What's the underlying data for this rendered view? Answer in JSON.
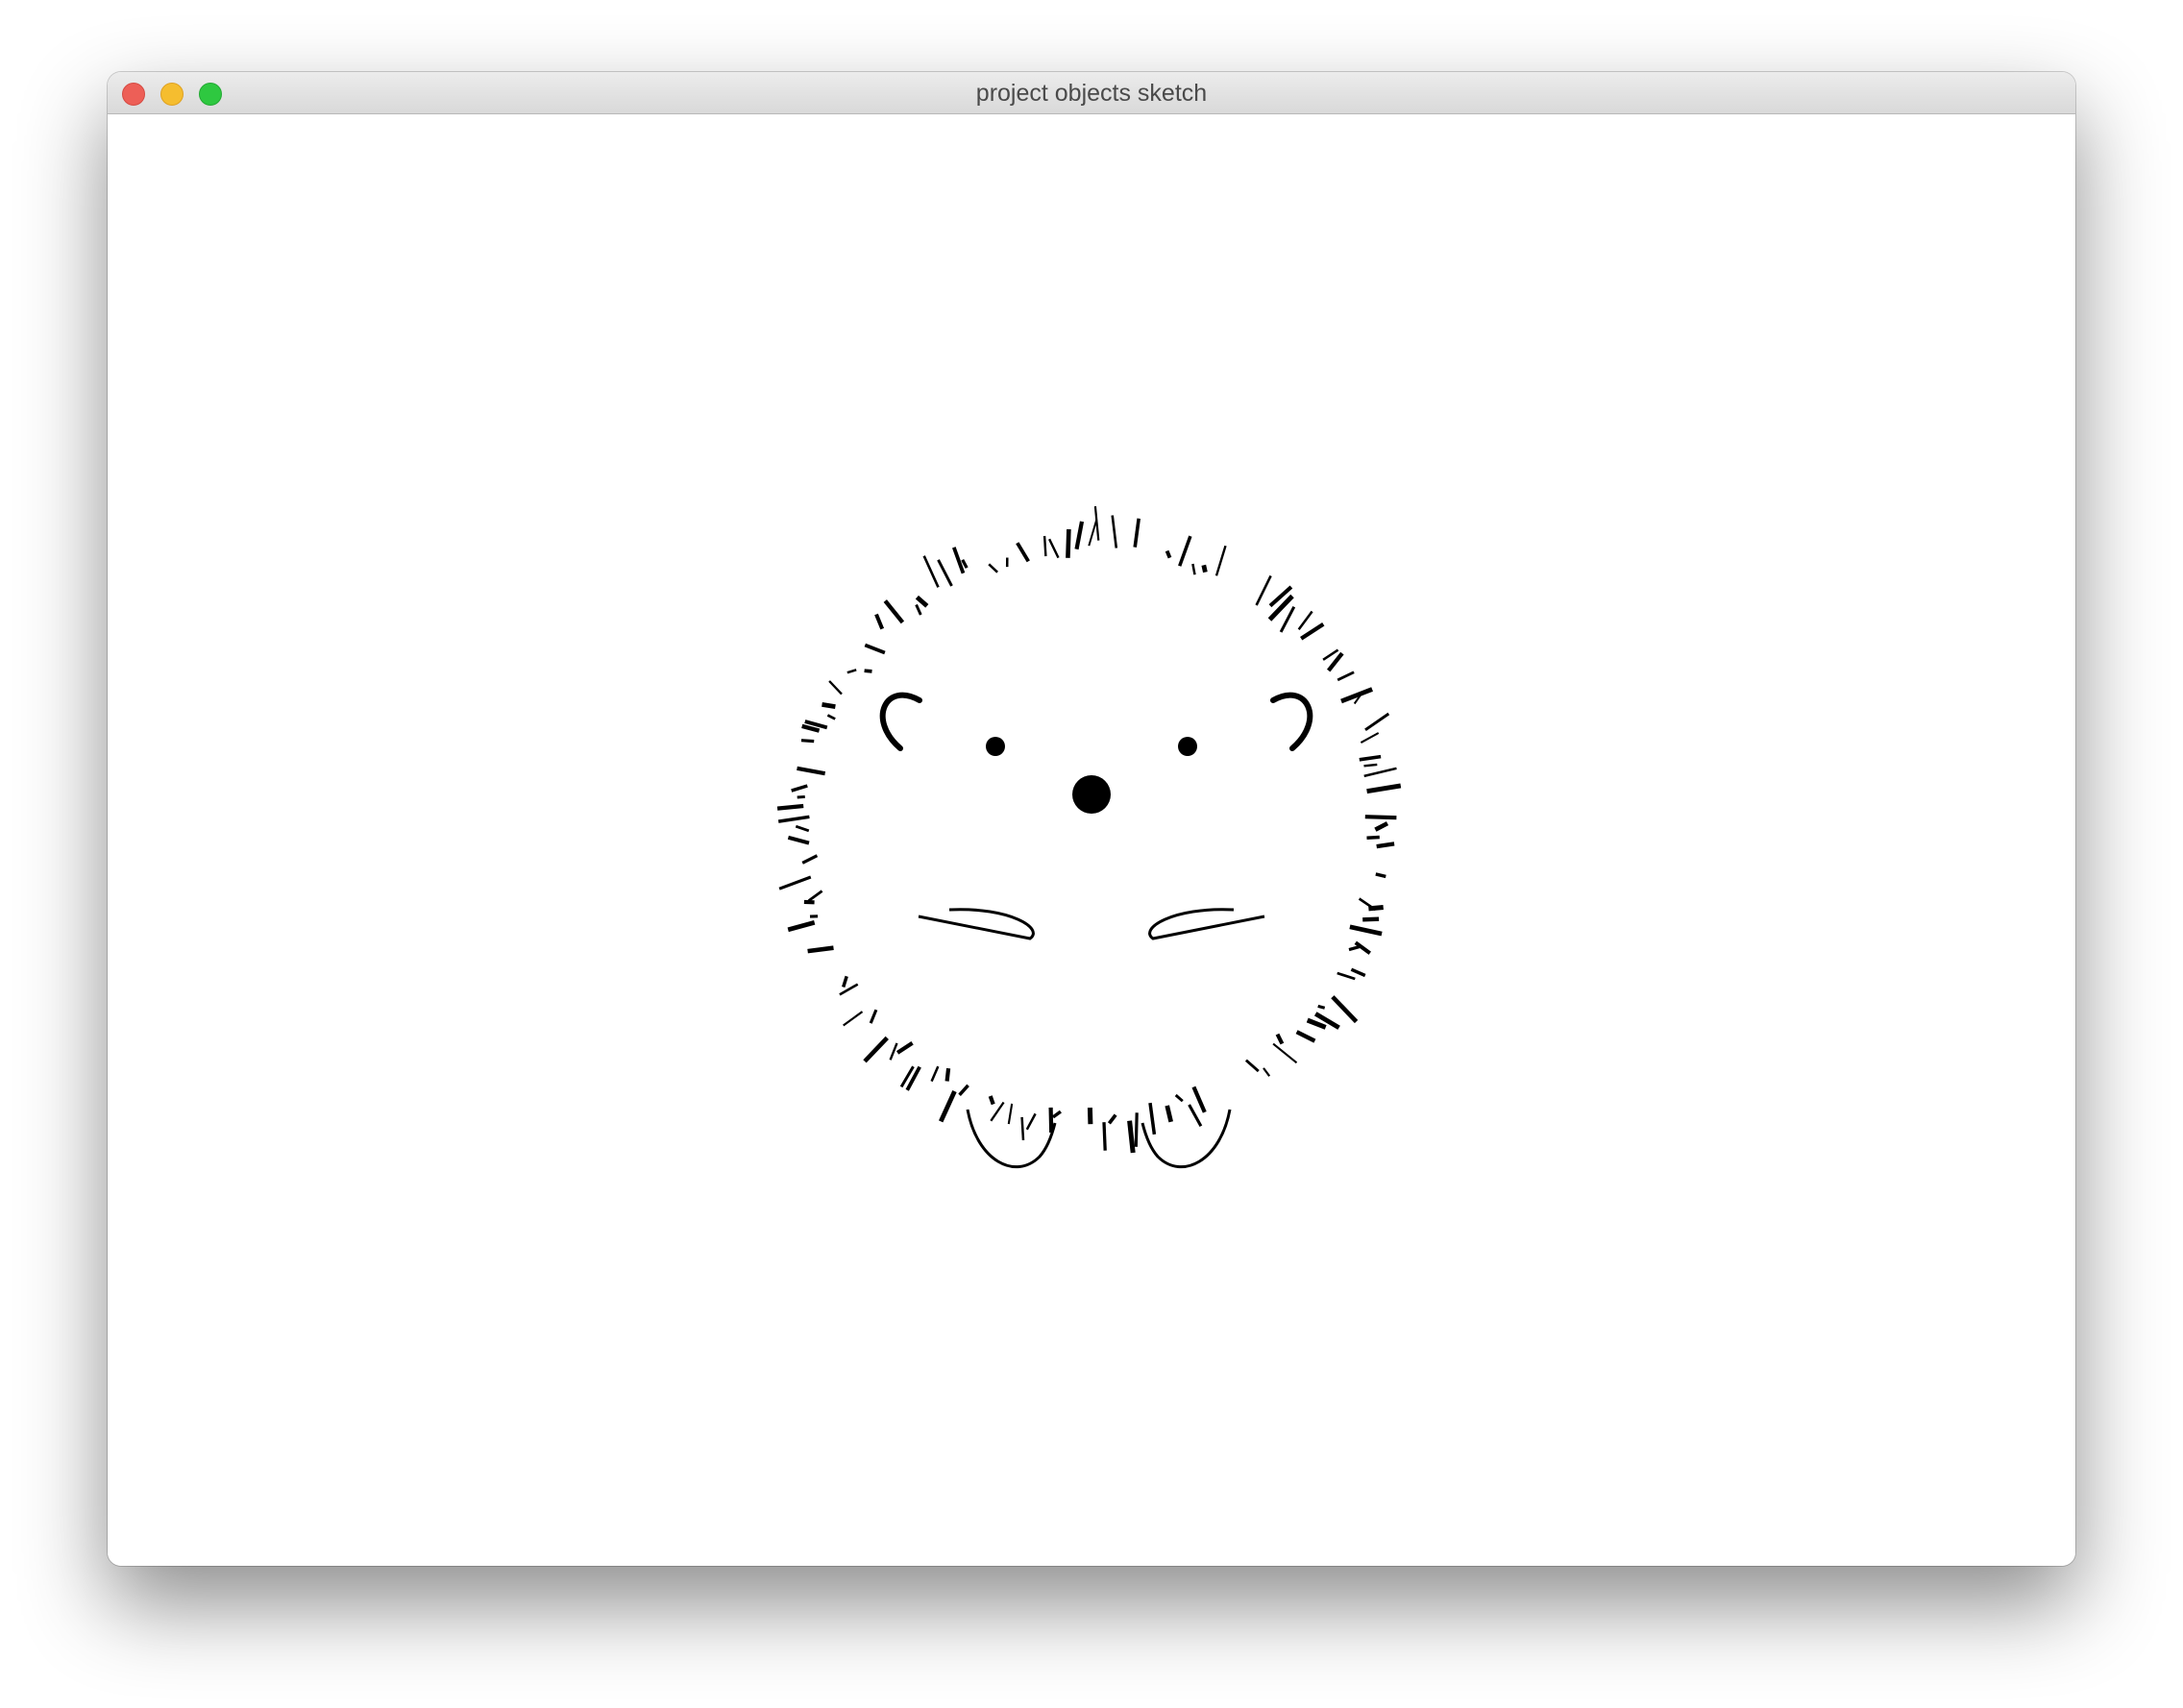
{
  "window": {
    "title": "project objects sketch"
  },
  "traffic_lights": {
    "close": "close",
    "minimize": "minimize",
    "zoom": "zoom"
  },
  "colors": {
    "close": "#ed5f57",
    "minimize": "#f5bd2f",
    "zoom": "#2ec840",
    "ink": "#000000",
    "canvas": "#ffffff"
  },
  "sketch": {
    "subject": "hedgehog",
    "parts": [
      "spines",
      "ears",
      "eyes",
      "nose",
      "whiskers",
      "feet"
    ]
  }
}
